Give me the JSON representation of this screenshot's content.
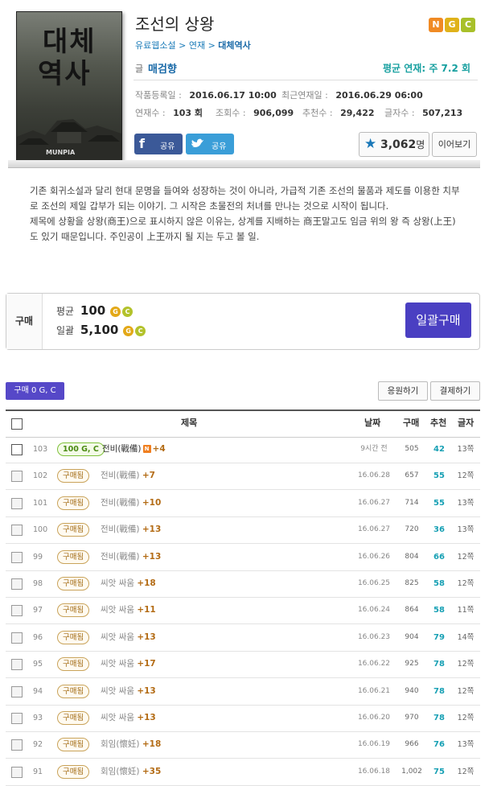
{
  "cover": {
    "title_line1": "대체",
    "title_line2": "역사",
    "publisher": "MUNPIA"
  },
  "novel": {
    "title": "조선의 상왕",
    "badges": [
      {
        "label": "N",
        "color": "#f08a24"
      },
      {
        "label": "G",
        "color": "#e0b21a"
      },
      {
        "label": "C",
        "color": "#a8c02a"
      }
    ],
    "breadcrumb": {
      "a": "유료웹소설",
      "sep": " > ",
      "b": "연재",
      "c": "대체역사"
    },
    "author_label": "글",
    "author": "매검향",
    "avg_serial": "평균 연재: 주 7.2 회",
    "registered_label": "작품등록일 :",
    "registered": "2016.06.17 10:00",
    "latest_label": "최근연재일 :",
    "latest": "2016.06.29 06:00",
    "episodes_label": "연재수 :",
    "episodes": "103 회",
    "views_label": "조회수 :",
    "views": "906,099",
    "recs_label": "추천수 :",
    "recs": "29,422",
    "chars_label": "글자수 :",
    "chars": "507,213",
    "share_fb": "공유",
    "share_tw": "공유",
    "rec_count": "3,062",
    "rec_unit": "명",
    "continue_label": "이어보기"
  },
  "synopsis": {
    "p1": "기존 회귀소설과 달리 현대 문명을 들여와 성장하는 것이 아니라, 가급적 기존 조선의 물품과 제도를 이용한 치부로 조선의 제일 갑부가 되는 이야기. 그 시작은 초물전의 처녀를 만나는 것으로 시작이 됩니다.",
    "p2": "제목에 상황을 상왕(商王)으로 표시하지 않은 이유는, 상계를 지배하는 商王말고도 임금 위의 왕 즉 상왕(上王)도 있기 때문입니다. 주인공이 上王까지 될 지는 두고 볼 일."
  },
  "purchase": {
    "label": "구매",
    "avg_label": "평균",
    "avg_price": "100",
    "bulk_label": "일괄",
    "bulk_price": "5,100",
    "bulk_button": "일괄구매",
    "coin_g": "G",
    "coin_c": "C"
  },
  "list": {
    "buy_tag": "구매 0 G, C",
    "support_btn": "응원하기",
    "settle_btn": "결제하기",
    "headers": {
      "title": "제목",
      "date": "날짜",
      "buy": "구매",
      "rec": "추천",
      "chars": "글자"
    },
    "rows": [
      {
        "no": "103",
        "tag": "100 G, C",
        "title": "전비(戰備)",
        "plus": "+4",
        "date": "9시간 전",
        "buy": "505",
        "rec": "42",
        "chars": "13쪽",
        "paid": true
      },
      {
        "no": "102",
        "tag": "구매됨",
        "title": "전비(戰備)",
        "plus": "+7",
        "date": "16.06.28",
        "buy": "657",
        "rec": "55",
        "chars": "12쪽"
      },
      {
        "no": "101",
        "tag": "구매됨",
        "title": "전비(戰備)",
        "plus": "+10",
        "date": "16.06.27",
        "buy": "714",
        "rec": "55",
        "chars": "13쪽"
      },
      {
        "no": "100",
        "tag": "구매됨",
        "title": "전비(戰備)",
        "plus": "+13",
        "date": "16.06.27",
        "buy": "720",
        "rec": "36",
        "chars": "13쪽"
      },
      {
        "no": "99",
        "tag": "구매됨",
        "title": "전비(戰備)",
        "plus": "+13",
        "date": "16.06.26",
        "buy": "804",
        "rec": "66",
        "chars": "12쪽"
      },
      {
        "no": "98",
        "tag": "구매됨",
        "title": "씨앗 싸움",
        "plus": "+18",
        "date": "16.06.25",
        "buy": "825",
        "rec": "58",
        "chars": "12쪽"
      },
      {
        "no": "97",
        "tag": "구매됨",
        "title": "씨앗 싸움",
        "plus": "+11",
        "date": "16.06.24",
        "buy": "864",
        "rec": "58",
        "chars": "11쪽"
      },
      {
        "no": "96",
        "tag": "구매됨",
        "title": "씨앗 싸움",
        "plus": "+13",
        "date": "16.06.23",
        "buy": "904",
        "rec": "79",
        "chars": "14쪽"
      },
      {
        "no": "95",
        "tag": "구매됨",
        "title": "씨앗 싸움",
        "plus": "+17",
        "date": "16.06.22",
        "buy": "925",
        "rec": "78",
        "chars": "12쪽"
      },
      {
        "no": "94",
        "tag": "구매됨",
        "title": "씨앗 싸움",
        "plus": "+13",
        "date": "16.06.21",
        "buy": "940",
        "rec": "78",
        "chars": "12쪽"
      },
      {
        "no": "93",
        "tag": "구매됨",
        "title": "씨앗 싸움",
        "plus": "+13",
        "date": "16.06.20",
        "buy": "970",
        "rec": "78",
        "chars": "12쪽"
      },
      {
        "no": "92",
        "tag": "구매됨",
        "title": "회임(懷妊)",
        "plus": "+18",
        "date": "16.06.19",
        "buy": "966",
        "rec": "76",
        "chars": "13쪽"
      },
      {
        "no": "91",
        "tag": "구매됨",
        "title": "회임(懷妊)",
        "plus": "+35",
        "date": "16.06.18",
        "buy": "1,002",
        "rec": "75",
        "chars": "12쪽"
      }
    ]
  }
}
